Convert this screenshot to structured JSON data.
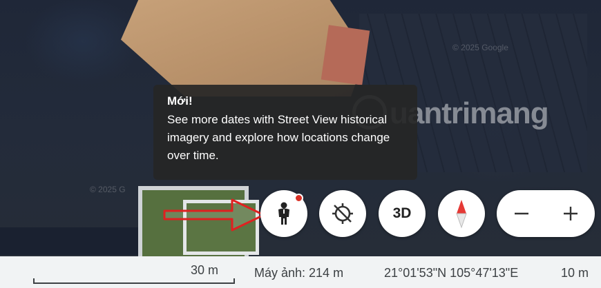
{
  "tooltip": {
    "title": "Mới!",
    "body": "See more dates with Street View historical imagery and explore how locations change over time."
  },
  "map": {
    "watermark_1": "© 2025 Google",
    "watermark_2": "© 2025 G",
    "logo_text": "uantrimang"
  },
  "controls": {
    "pegman_icon": "pegman-icon",
    "location_icon": "location-off-icon",
    "three_d_label": "3D",
    "compass_icon": "compass-icon",
    "zoom_out_label": "−",
    "zoom_in_label": "+",
    "notification_color": "#d93025"
  },
  "statusbar": {
    "scale_label": "30 m",
    "camera_label": "Máy ảnh: 214 m",
    "coordinates": "21°01'53\"N 105°47'13\"E",
    "altitude": "10 m"
  },
  "annotation": {
    "arrow_color": "#e02020"
  }
}
